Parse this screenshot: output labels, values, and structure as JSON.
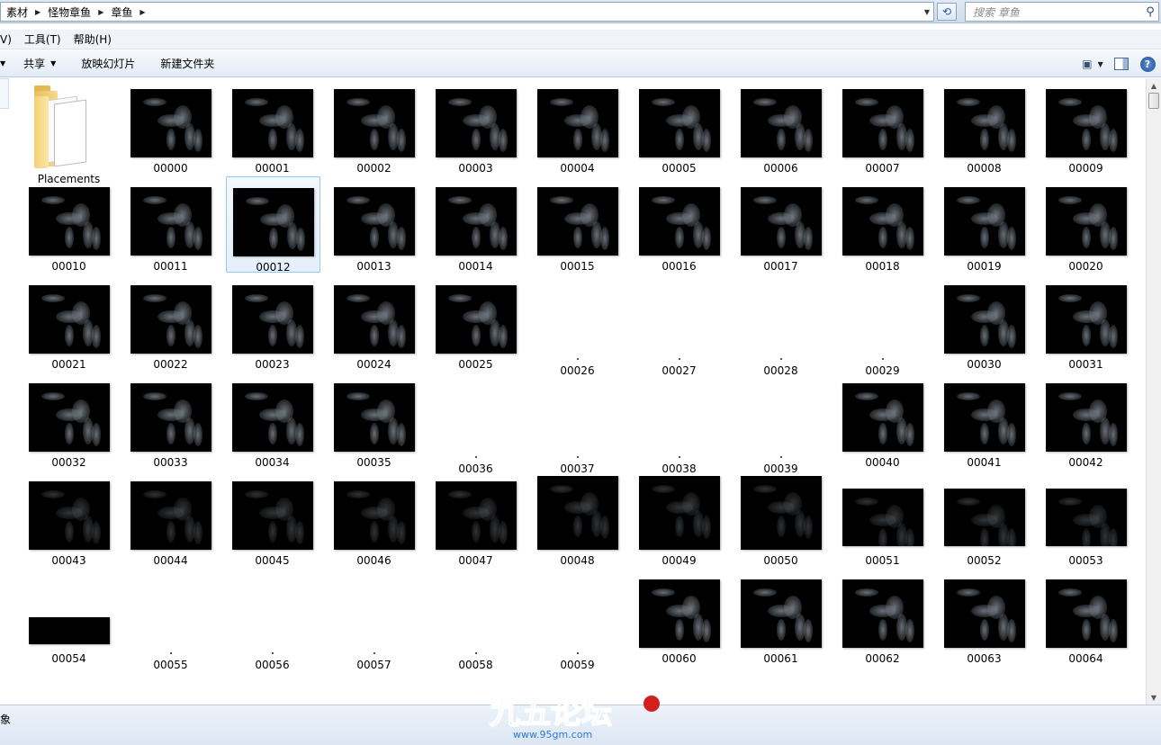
{
  "address": {
    "crumbs": [
      "素材",
      "怪物章鱼",
      "章鱼"
    ],
    "search_placeholder": "搜索 章鱼"
  },
  "menu": [
    "V)",
    "工具(T)",
    "帮助(H)"
  ],
  "commands": {
    "share": "共享",
    "slideshow": "放映幻灯片",
    "new_folder": "新建文件夹"
  },
  "folder": {
    "name": "Placements"
  },
  "files": [
    "00000",
    "00001",
    "00002",
    "00003",
    "00004",
    "00005",
    "00006",
    "00007",
    "00008",
    "00009",
    "00010",
    "00011",
    "00012",
    "00013",
    "00014",
    "00015",
    "00016",
    "00017",
    "00018",
    "00019",
    "00020",
    "00021",
    "00022",
    "00023",
    "00024",
    "00025",
    "00026",
    "00027",
    "00028",
    "00029",
    "00030",
    "00031",
    "00032",
    "00033",
    "00034",
    "00035",
    "00036",
    "00037",
    "00038",
    "00039",
    "00040",
    "00041",
    "00042",
    "00043",
    "00044",
    "00045",
    "00046",
    "00047",
    "00048",
    "00049",
    "00050",
    "00051",
    "00052",
    "00053",
    "00054",
    "00055",
    "00056",
    "00057",
    "00058",
    "00059",
    "00060",
    "00061",
    "00062",
    "00063",
    "00064"
  ],
  "empty_files": [
    "00026",
    "00027",
    "00028",
    "00029",
    "00036",
    "00037",
    "00038",
    "00039",
    "00055",
    "00056",
    "00057",
    "00058",
    "00059"
  ],
  "selected_file": "00012",
  "status": {
    "text": "象"
  },
  "watermark": {
    "logo": "九五论坛",
    "url": "www.95gm.com"
  }
}
